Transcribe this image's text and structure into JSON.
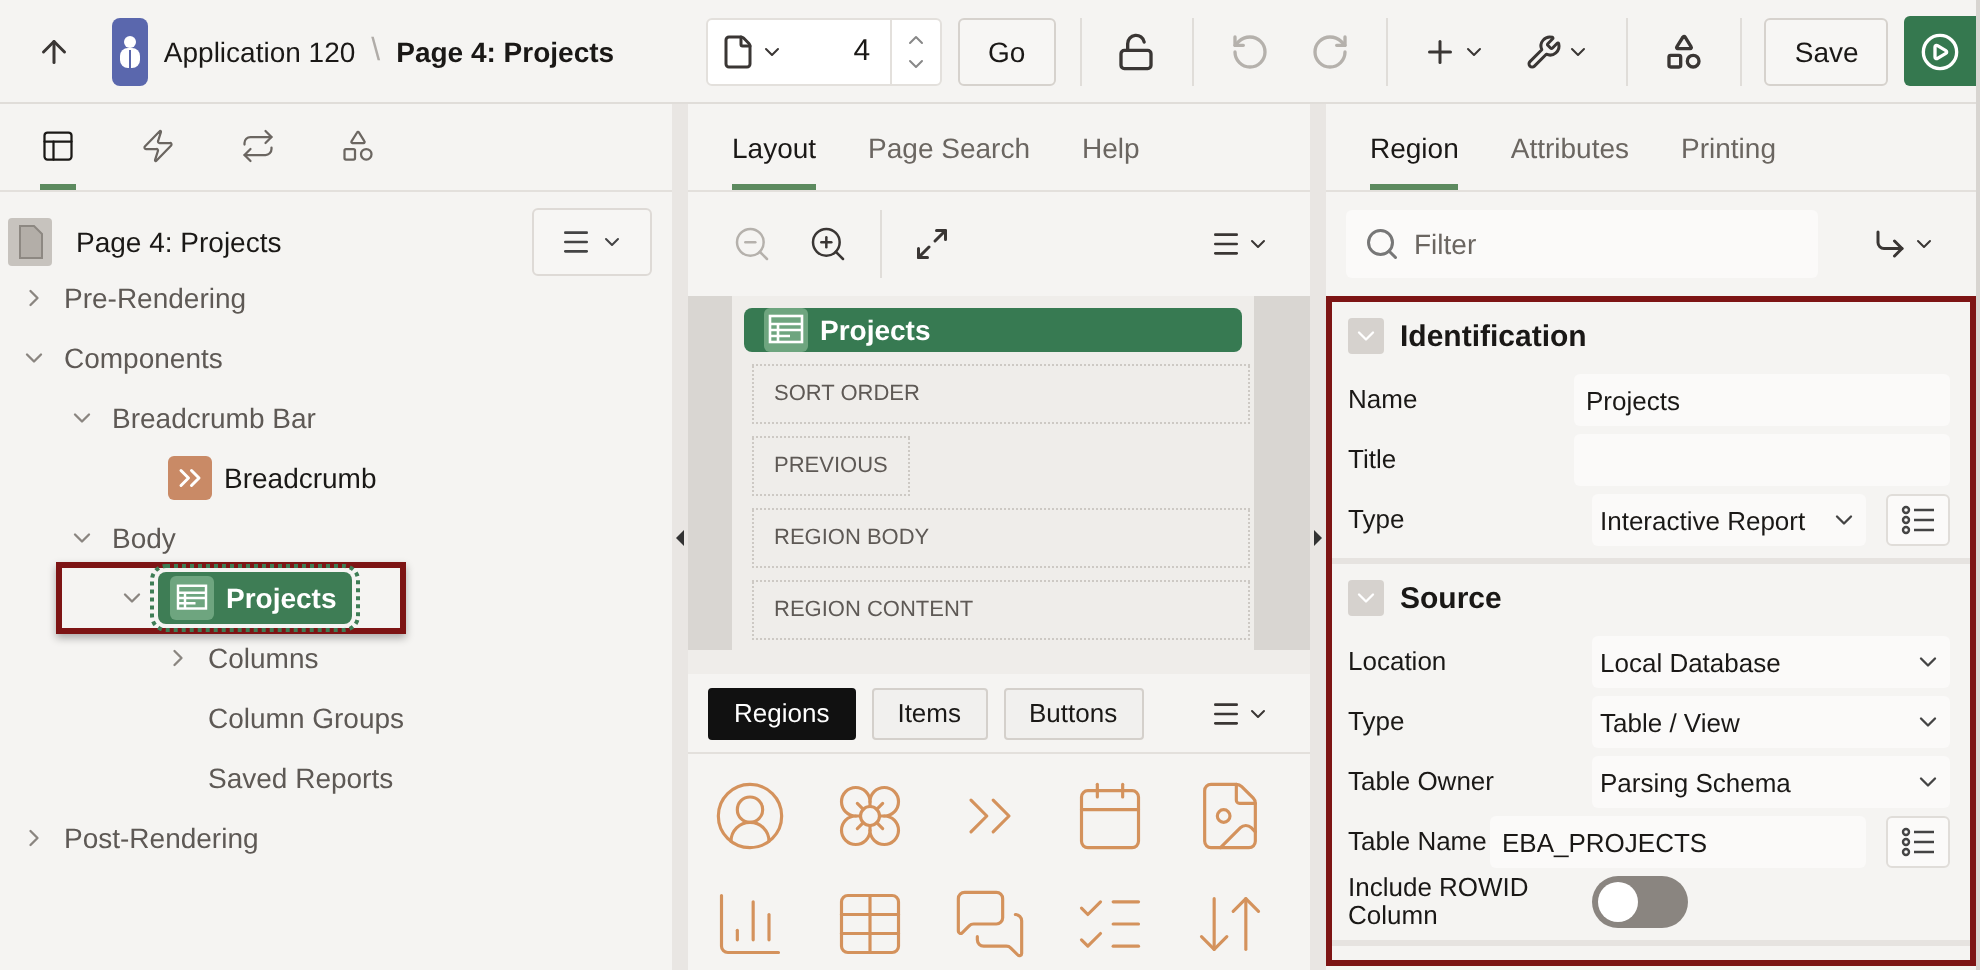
{
  "toolbar": {
    "app_name": "Application 120",
    "separator": "\\",
    "page_title": "Page 4: Projects",
    "page_number": "4",
    "go": "Go",
    "undo_disabled": true,
    "redo_disabled": true,
    "save": "Save"
  },
  "left_tabs": [
    {
      "kind": "rendering",
      "selected": true
    },
    {
      "kind": "dynamic-actions",
      "selected": false
    },
    {
      "kind": "processing",
      "selected": false
    },
    {
      "kind": "shared",
      "selected": false
    }
  ],
  "tree": {
    "label": "Page 4: Projects",
    "kind": "page",
    "children": [
      {
        "label": "Pre-Rendering",
        "expanded": false
      },
      {
        "label": "Components",
        "expanded": true,
        "children": [
          {
            "label": "Breadcrumb Bar",
            "expanded": true,
            "children": [
              {
                "label": "Breadcrumb",
                "kind": "breadcrumb"
              }
            ]
          },
          {
            "label": "Body",
            "expanded": true,
            "children": [
              {
                "label": "Projects",
                "kind": "report",
                "expanded": true,
                "selected": true,
                "highlighted": true,
                "children": [
                  {
                    "label": "Columns",
                    "expanded": false
                  },
                  {
                    "label": "Column Groups"
                  },
                  {
                    "label": "Saved Reports"
                  }
                ]
              }
            ]
          }
        ]
      },
      {
        "label": "Post-Rendering",
        "expanded": false
      }
    ]
  },
  "middle_tabs": [
    {
      "label": "Layout",
      "selected": true
    },
    {
      "label": "Page Search",
      "selected": false
    },
    {
      "label": "Help",
      "selected": false
    }
  ],
  "layout_toolbar": {
    "zoom_out_disabled": true
  },
  "canvas": {
    "region_title": "Projects",
    "slots": [
      {
        "label": "SORT ORDER",
        "kind": "full"
      },
      {
        "label": "PREVIOUS",
        "kind": "fit"
      },
      {
        "label": "REGION BODY",
        "kind": "full"
      },
      {
        "label": "REGION CONTENT",
        "kind": "full"
      }
    ]
  },
  "gallery_tabs": [
    {
      "label": "Regions",
      "selected": true
    },
    {
      "label": "Items",
      "selected": false
    },
    {
      "label": "Buttons",
      "selected": false
    }
  ],
  "right_tabs": [
    {
      "label": "Region",
      "selected": true
    },
    {
      "label": "Attributes",
      "selected": false
    },
    {
      "label": "Printing",
      "selected": false
    }
  ],
  "filter": {
    "placeholder": "Filter"
  },
  "property_groups": {
    "highlighted": true,
    "groups": [
      {
        "title": "Identification",
        "expanded": true,
        "properties": [
          {
            "label": "Name",
            "kind": "text",
            "value": "Projects"
          },
          {
            "label": "Title",
            "kind": "text"
          },
          {
            "label": "Type",
            "kind": "select",
            "value": "Interactive Report",
            "list_button": true
          }
        ]
      },
      {
        "title": "Source",
        "expanded": true,
        "properties": [
          {
            "label": "Location",
            "kind": "select",
            "value": "Local Database"
          },
          {
            "label": "Type",
            "kind": "select",
            "value": "Table / View"
          },
          {
            "label": "Table Owner",
            "kind": "select",
            "value": "Parsing Schema"
          },
          {
            "label": "Table Name",
            "kind": "text",
            "value": "EBA_PROJECTS",
            "list_button": true
          },
          {
            "label": "Include ROWID Column",
            "kind": "switch",
            "on": false
          }
        ]
      }
    ]
  }
}
